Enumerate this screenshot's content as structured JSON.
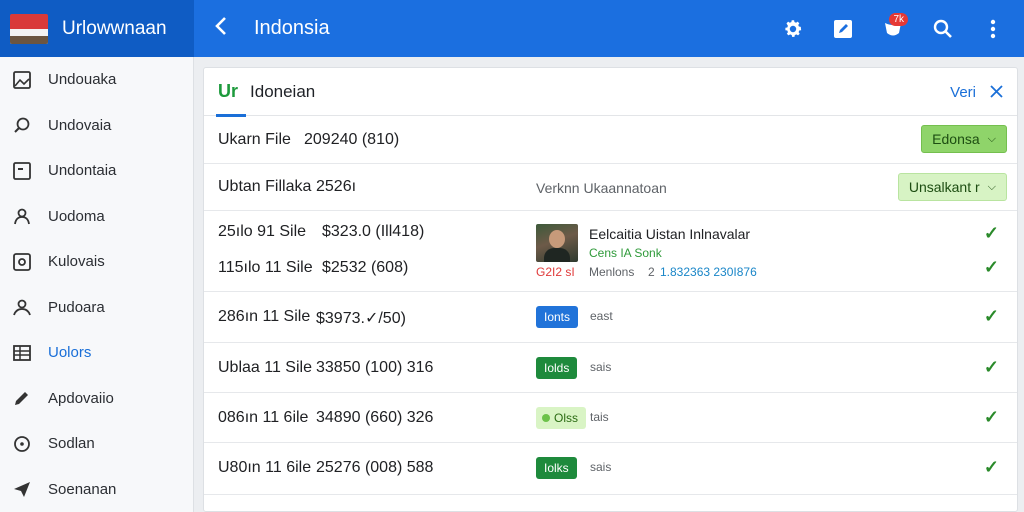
{
  "header": {
    "brand_title": "Urlowwnaan",
    "back_icon": "chevron-left-icon",
    "page_title": "Indonsia",
    "badge_count": "7k",
    "accent_color": "#1b6fe0"
  },
  "sidebar": {
    "items": [
      {
        "label": "Undouaka",
        "icon": "image-icon"
      },
      {
        "label": "Undovaia",
        "icon": "search-icon"
      },
      {
        "label": "Undontaia",
        "icon": "square-icon"
      },
      {
        "label": "Uodoma",
        "icon": "person-icon"
      },
      {
        "label": "Kulovais",
        "icon": "target-icon"
      },
      {
        "label": "Pudoara",
        "icon": "user-icon"
      },
      {
        "label": "Uolors",
        "icon": "table-icon",
        "active": true
      },
      {
        "label": "Apdovaiio",
        "icon": "pencil-icon"
      },
      {
        "label": "Sodlan",
        "icon": "info-icon"
      },
      {
        "label": "Soenanan",
        "icon": "send-icon"
      }
    ]
  },
  "panel": {
    "tab_logo": "Ur",
    "tab_label": "Idoneian",
    "verify_label": "Veri",
    "row1": {
      "label": "Ukarn File",
      "value": "209240 (810)",
      "button": "Edonsa"
    },
    "row2": {
      "label": "Ubtan Fillaka",
      "value": "2526ı",
      "middle": "Verknn Ukaannatoan",
      "button": "Unsalkant r"
    },
    "row3": {
      "line1_label": "25ılo 91 Sile",
      "line1_value": "$323.0 (Ill418)",
      "line2_label": "115ılo 11 Sile",
      "line2_value": "$2532 (608)",
      "title": "Eelcaitia Uistan Inlnavalar",
      "green_text": "Cens IA Sonk",
      "red_text": "G2I2 sI",
      "meta_label": "Menlons",
      "meta_num": "2",
      "teal_text": "1.832363 230I876"
    },
    "rows": [
      {
        "label": "286ın 11 Sile",
        "value": "$3973.✓/50)",
        "pill": "Ionts",
        "pill_style": "blue",
        "tag": "east"
      },
      {
        "label": "Ublaa 11 Sile",
        "value": "33850 (100) 316",
        "pill": "Iolds",
        "pill_style": "green",
        "tag": "sais"
      },
      {
        "label": "086ın 11 6ile",
        "value": "34890 (660) 326",
        "pill": "Olss",
        "pill_style": "lightgreen",
        "tag": "tais"
      },
      {
        "label": "U80ın 11 6ile",
        "value": "25276 (008) 588",
        "pill": "Iolks",
        "pill_style": "green",
        "tag": "sais"
      }
    ]
  }
}
